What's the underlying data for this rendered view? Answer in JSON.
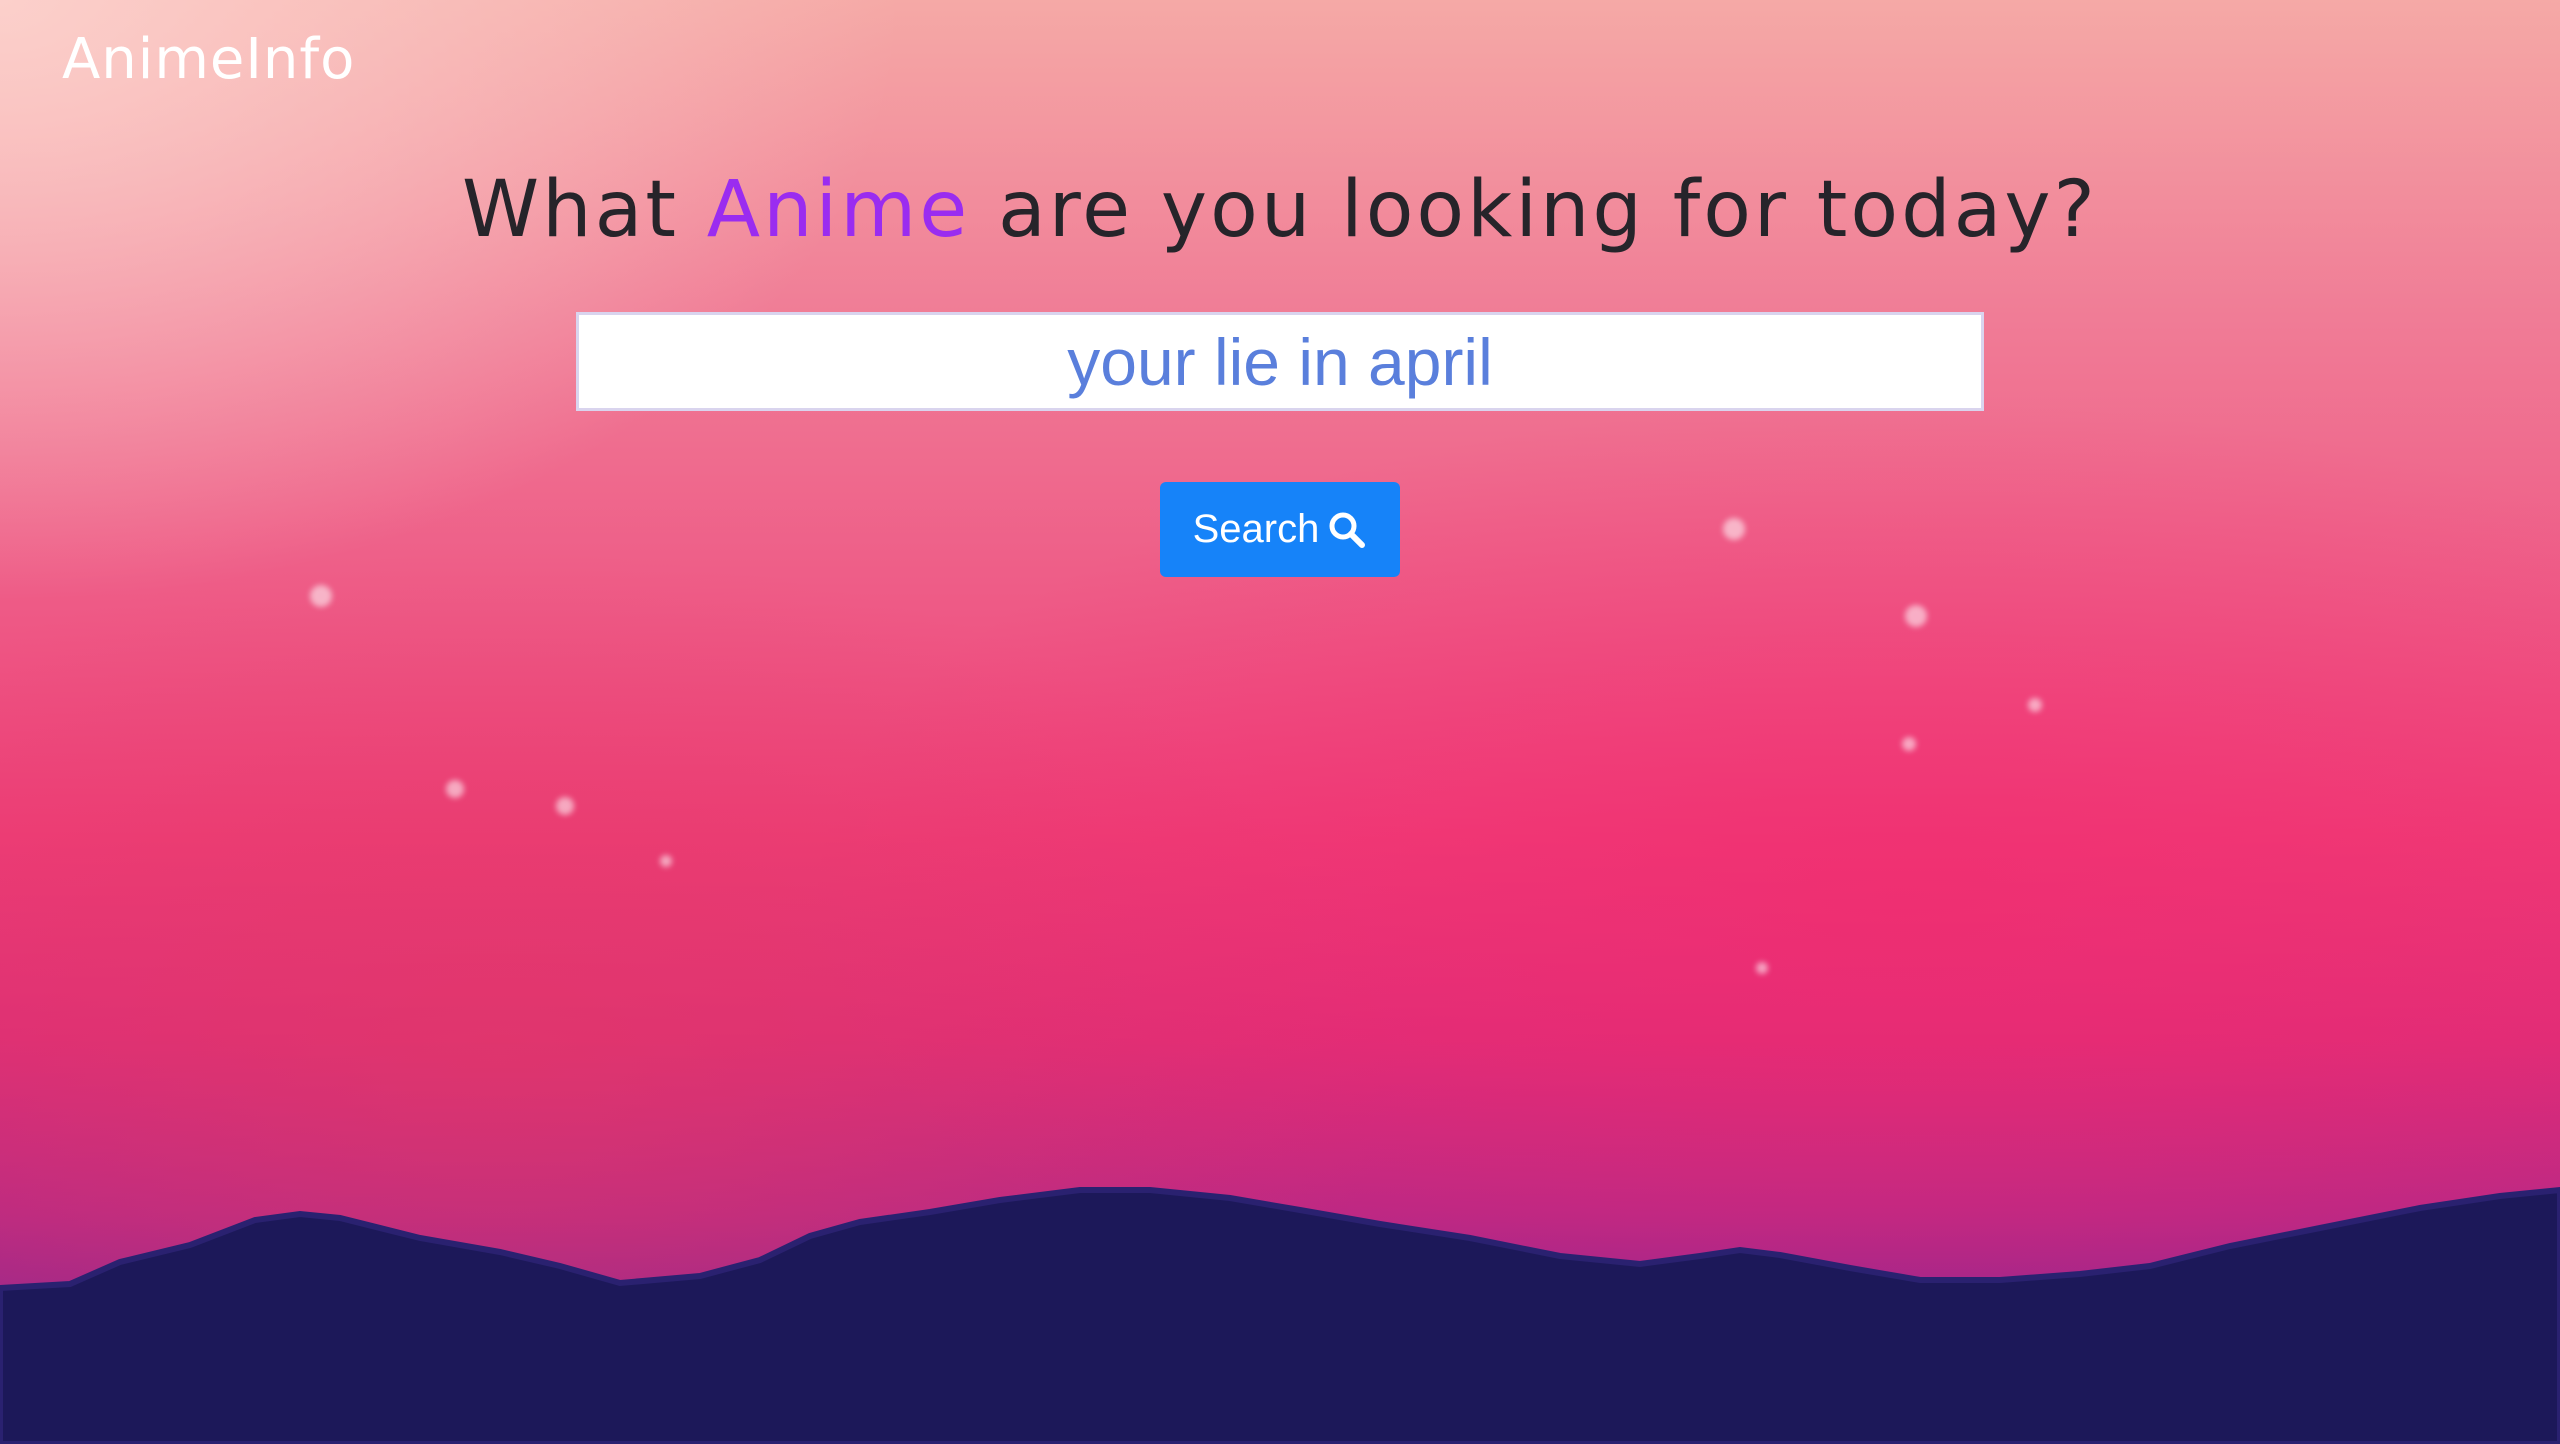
{
  "brand": {
    "logo": "AnimeInfo"
  },
  "hero": {
    "headline_before": "What ",
    "headline_accent": "Anime",
    "headline_after": " are you looking for today?"
  },
  "search": {
    "value": "your lie in april",
    "button_label": "Search",
    "button_icon": "search-icon"
  },
  "colors": {
    "accent": "#9a2cf0",
    "button": "#1683f9",
    "input_text": "#5a7fdc",
    "hills": "#1c1859"
  }
}
